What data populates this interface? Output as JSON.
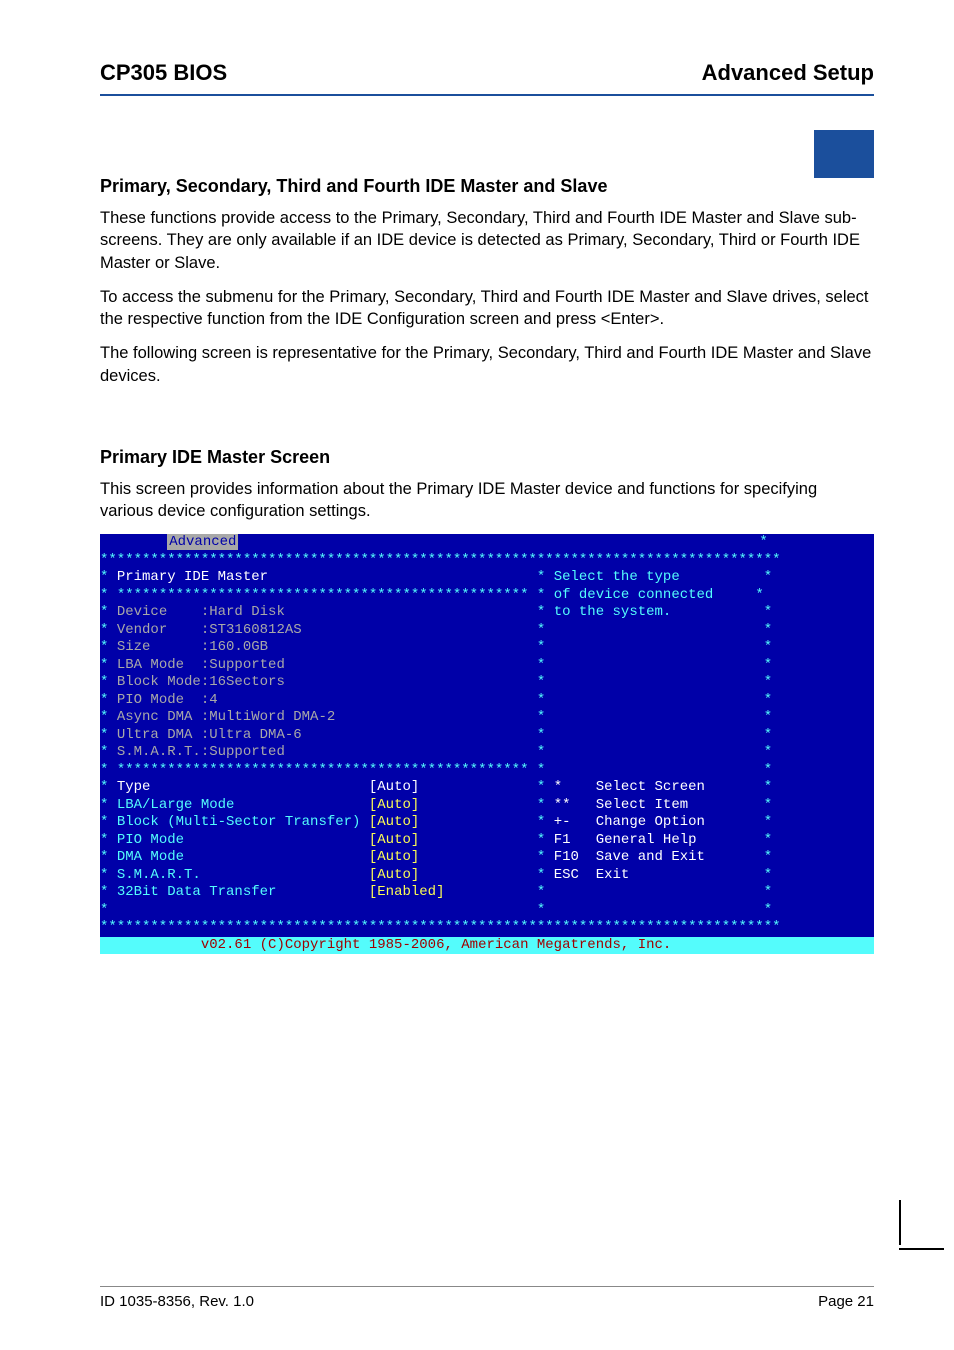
{
  "header": {
    "left": "CP305 BIOS",
    "right": "Advanced Setup"
  },
  "section1": {
    "title": "Primary, Secondary, Third and Fourth IDE Master and Slave",
    "p1": "These functions provide access to the Primary, Secondary, Third and Fourth IDE Master and Slave sub-screens. They are only available if an IDE device is detected as Primary, Secondary, Third or Fourth IDE Master or Slave.",
    "p2": "To access the submenu for the Primary, Secondary, Third and Fourth IDE Master and Slave drives, select the respective function from the IDE Configuration screen and press <Enter>.",
    "p3": "The following screen is representative for the Primary, Secondary, Third and Fourth IDE Master and Slave devices."
  },
  "section2": {
    "title": "Primary IDE Master Screen",
    "p1": "This screen provides information about the Primary IDE Master device and functions for specifying various device configuration settings."
  },
  "bios": {
    "tab": "Advanced",
    "title": "Primary IDE Master",
    "help_line1": "Select the type",
    "help_line2": "of device connected",
    "help_line3": "to the system.",
    "info_rows": [
      {
        "label": "Device",
        "value": ":Hard Disk"
      },
      {
        "label": "Vendor",
        "value": ":ST3160812AS"
      },
      {
        "label": "Size",
        "value": ":160.0GB"
      },
      {
        "label": "LBA Mode",
        "value": ":Supported"
      },
      {
        "label": "Block Mode",
        "value": ":16Sectors"
      },
      {
        "label": "PIO Mode",
        "value": ":4"
      },
      {
        "label": "Async DMA",
        "value": ":MultiWord DMA-2"
      },
      {
        "label": "Ultra DMA",
        "value": ":Ultra DMA-6"
      },
      {
        "label": "S.M.A.R.T.",
        "value": ":Supported"
      }
    ],
    "settings": [
      {
        "label": "Type",
        "value": "[Auto]",
        "highlight": true
      },
      {
        "label": "LBA/Large Mode",
        "value": "[Auto]"
      },
      {
        "label": "Block (Multi-Sector Transfer)",
        "value": "[Auto]"
      },
      {
        "label": "PIO Mode",
        "value": "[Auto]"
      },
      {
        "label": "DMA Mode",
        "value": "[Auto]"
      },
      {
        "label": "S.M.A.R.T.",
        "value": "[Auto]"
      },
      {
        "label": "32Bit Data Transfer",
        "value": "[Enabled]"
      }
    ],
    "nav": [
      {
        "key": "*",
        "action": "Select Screen"
      },
      {
        "key": "**",
        "action": "Select Item"
      },
      {
        "key": "+-",
        "action": "Change Option"
      },
      {
        "key": "F1",
        "action": "General Help"
      },
      {
        "key": "F10",
        "action": "Save and Exit"
      },
      {
        "key": "ESC",
        "action": "Exit"
      }
    ],
    "copyright": "v02.61 (C)Copyright 1985-2006, American Megatrends, Inc."
  },
  "footer": {
    "left": "ID 1035-8356, Rev. 1.0",
    "right": "Page 21"
  }
}
